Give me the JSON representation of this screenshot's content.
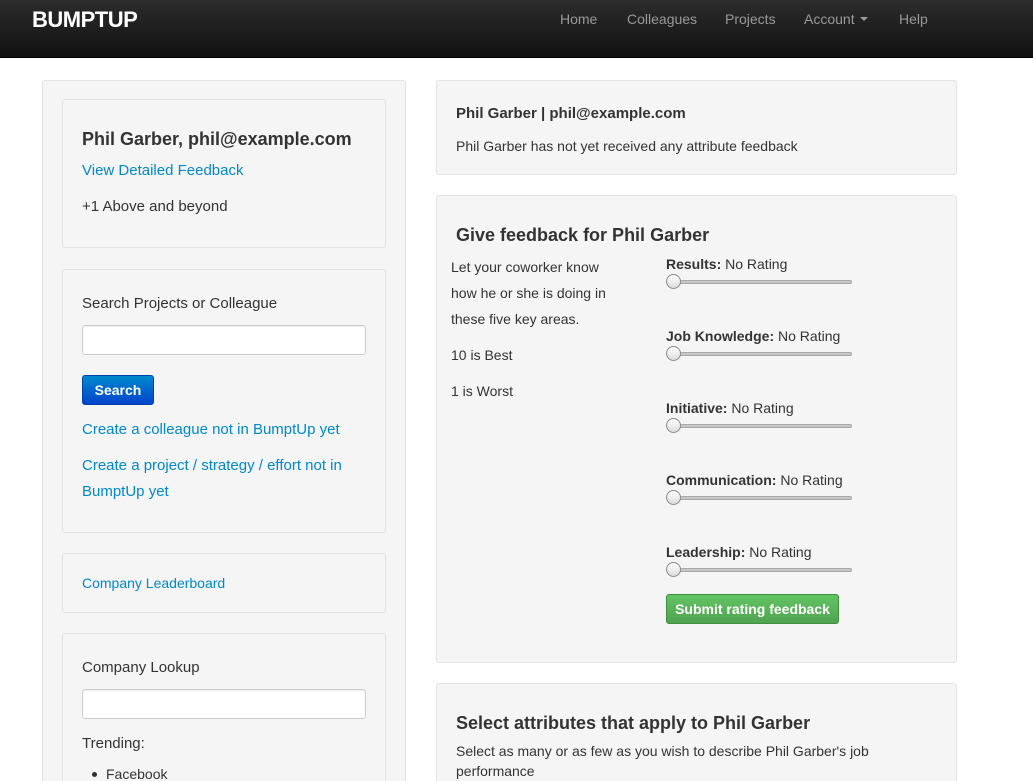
{
  "brand": "BUMPTUP",
  "nav": {
    "home": "Home",
    "colleagues": "Colleagues",
    "projects": "Projects",
    "account": "Account",
    "help": "Help"
  },
  "profile_card": {
    "name": "Phil Garber, phil@example.com",
    "detailed_feedback_link": "View Detailed Feedback",
    "attribute": "+1 Above and beyond"
  },
  "search_card": {
    "label": "Search Projects or Colleague",
    "input_value": "",
    "button": "Search",
    "create_colleague_link": "Create a colleague not in BumptUp yet",
    "create_project_link_line1": "Create a project / strategy / effort not in",
    "create_project_link_line2": "BumptUp yet"
  },
  "leaderboard_link": "Company Leaderboard",
  "lookup_card": {
    "label": "Company Lookup",
    "input_value": "",
    "trending_label": "Trending:",
    "trending_items": [
      "Facebook"
    ]
  },
  "summary_card": {
    "title": "Phil Garber | phil@example.com",
    "message": "Phil Garber has not yet received any attribute feedback"
  },
  "feedback_card": {
    "title": "Give feedback for Phil Garber",
    "intro_line1": "Let your coworker know",
    "intro_line2": "how he or she is doing in",
    "intro_line3": "these five key areas.",
    "best": "10 is Best",
    "worst": "1 is Worst",
    "sliders": [
      {
        "label": "Results:",
        "value": "No Rating"
      },
      {
        "label": "Job Knowledge:",
        "value": "No Rating"
      },
      {
        "label": "Initiative:",
        "value": "No Rating"
      },
      {
        "label": "Communication:",
        "value": "No Rating"
      },
      {
        "label": "Leadership:",
        "value": "No Rating"
      }
    ],
    "submit_button": "Submit rating feedback"
  },
  "attributes_card": {
    "title": "Select attributes that apply to Phil Garber",
    "desc_line1": "Select as many or as few as you wish to describe Phil Garber's job",
    "desc_line2": "performance"
  }
}
